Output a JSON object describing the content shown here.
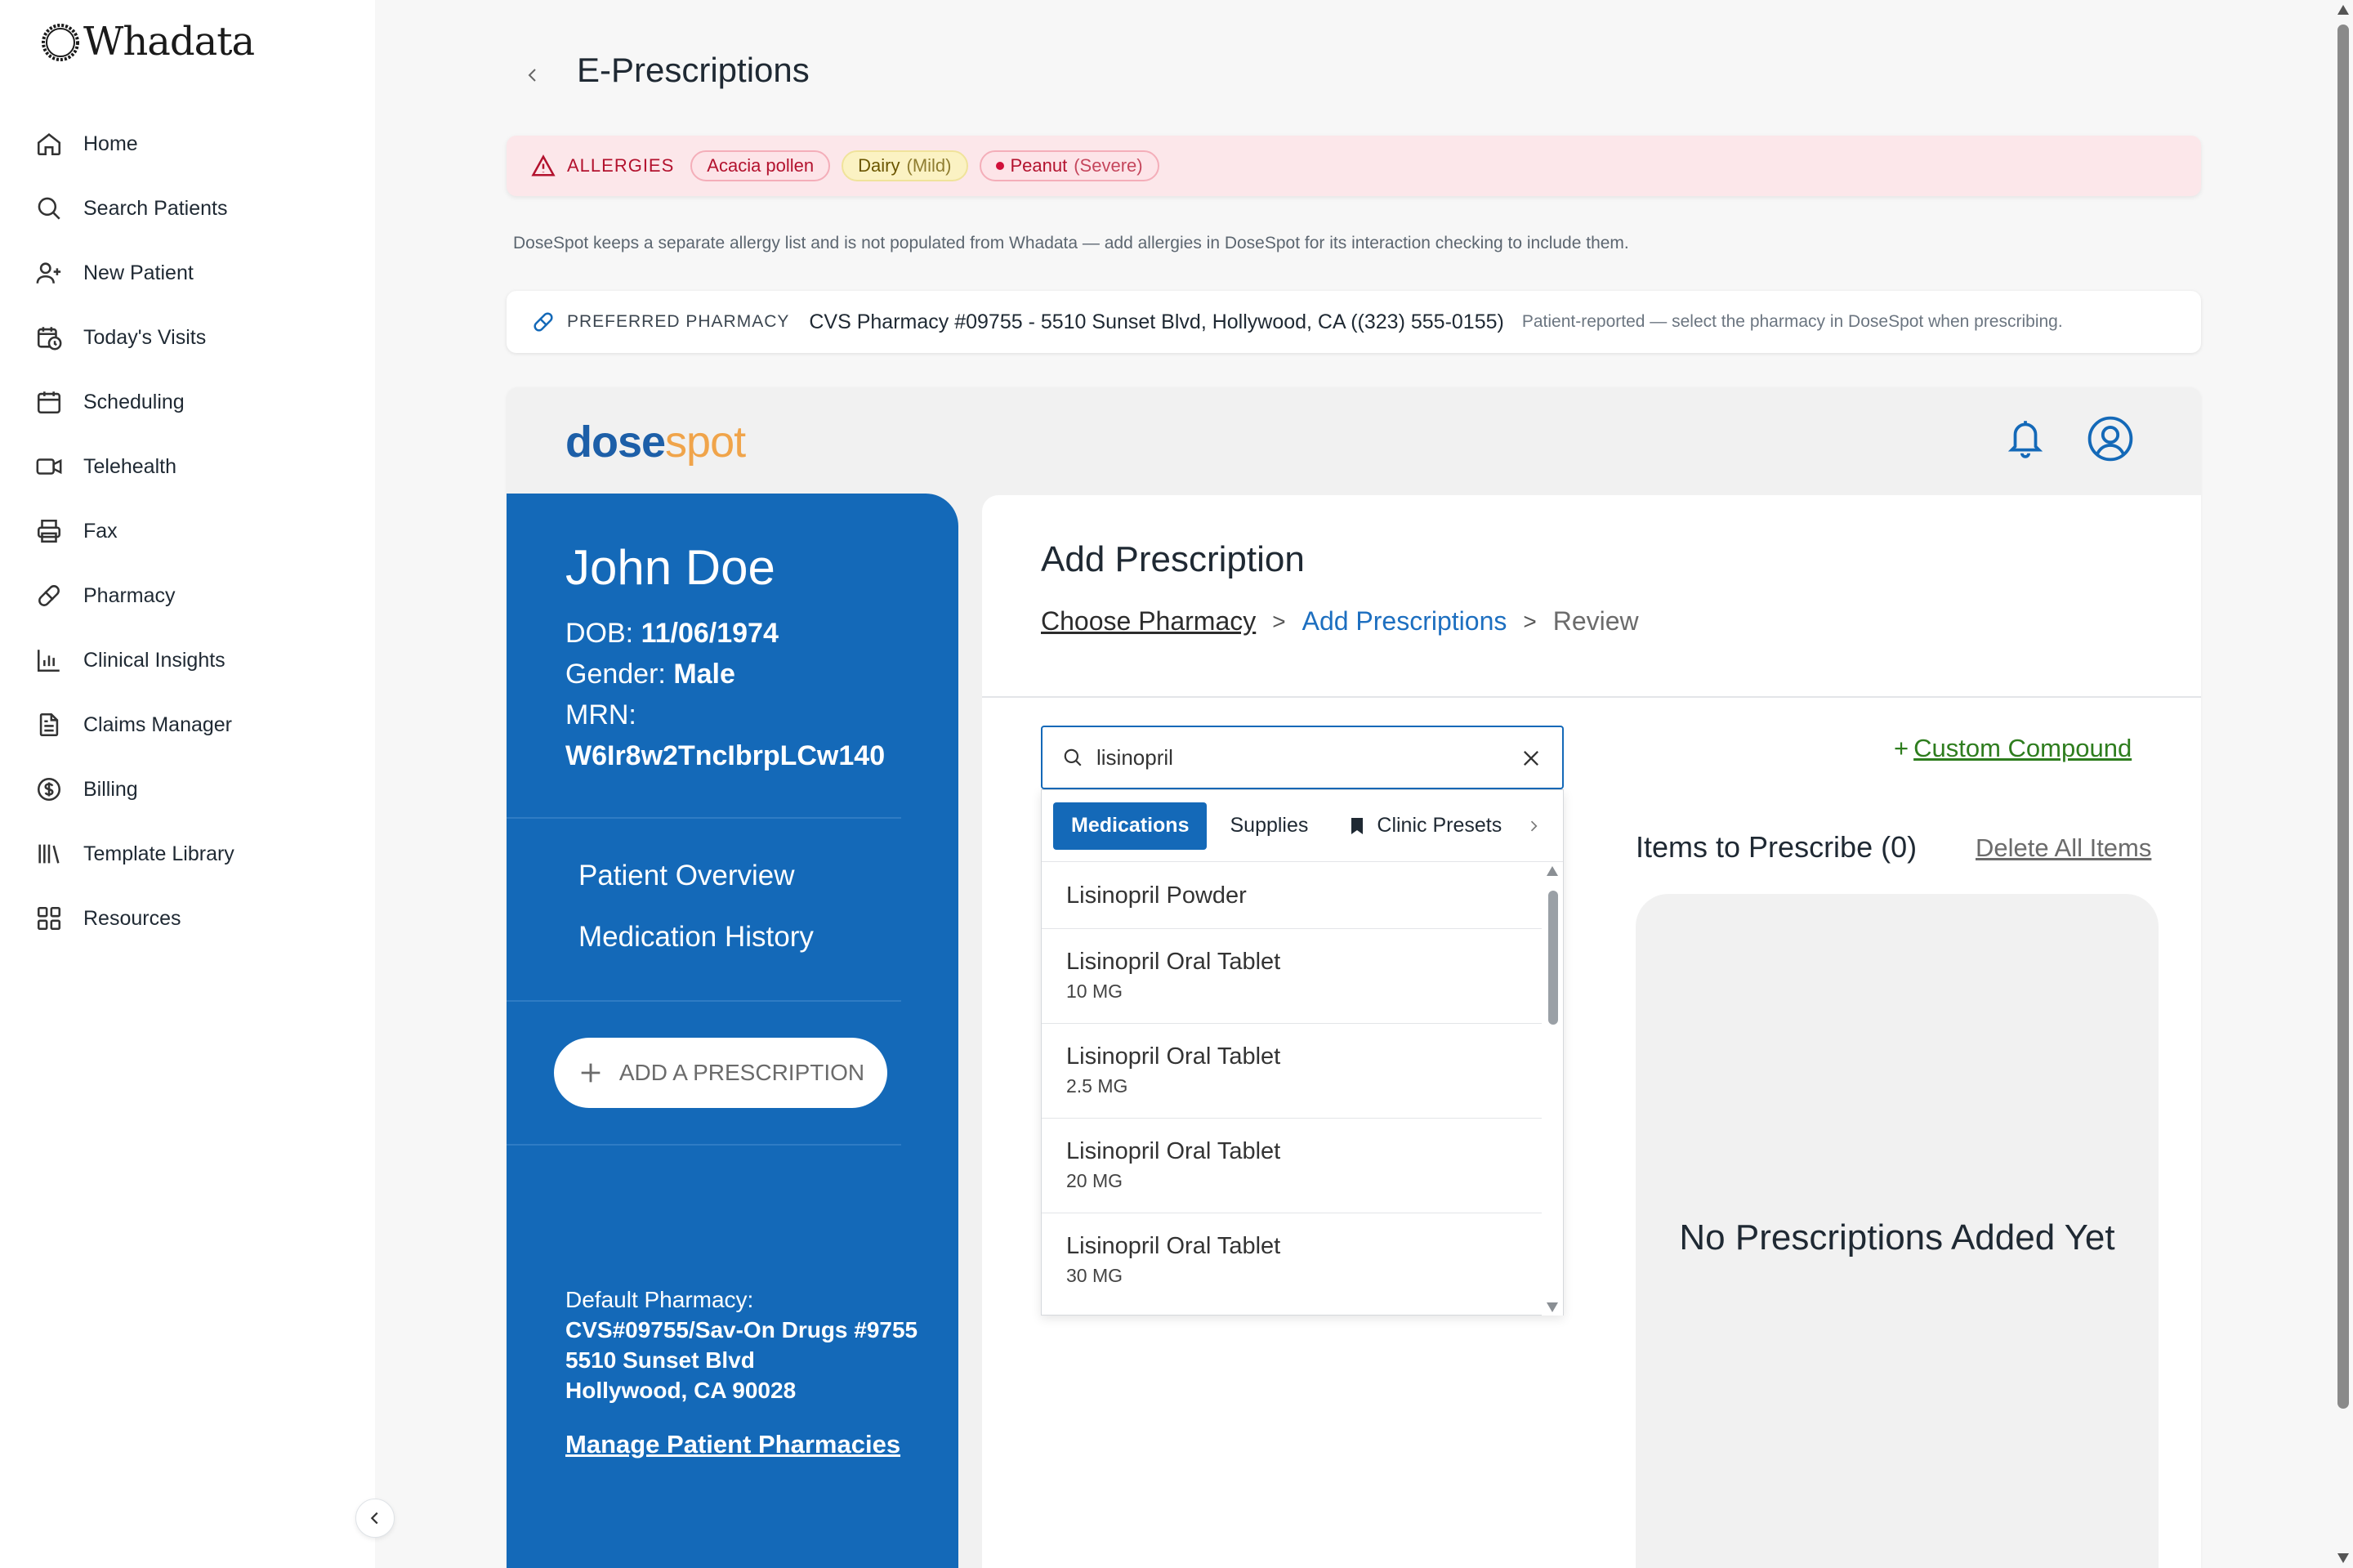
{
  "brand": {
    "logo_text": "Whadata"
  },
  "sidebar": {
    "items": [
      {
        "label": "Home",
        "icon": "home-icon"
      },
      {
        "label": "Search Patients",
        "icon": "search-icon"
      },
      {
        "label": "New Patient",
        "icon": "user-plus-icon"
      },
      {
        "label": "Today's Visits",
        "icon": "calendar-clock-icon"
      },
      {
        "label": "Scheduling",
        "icon": "calendar-icon"
      },
      {
        "label": "Telehealth",
        "icon": "video-icon"
      },
      {
        "label": "Fax",
        "icon": "printer-icon"
      },
      {
        "label": "Pharmacy",
        "icon": "pill-icon"
      },
      {
        "label": "Clinical Insights",
        "icon": "bar-chart-icon"
      },
      {
        "label": "Claims Manager",
        "icon": "document-icon"
      },
      {
        "label": "Billing",
        "icon": "dollar-icon"
      },
      {
        "label": "Template Library",
        "icon": "library-icon"
      },
      {
        "label": "Resources",
        "icon": "grid-icon"
      }
    ]
  },
  "page": {
    "title": "E-Prescriptions"
  },
  "allergies": {
    "label": "ALLERGIES",
    "items": [
      {
        "name": "Acacia pollen",
        "severity": ""
      },
      {
        "name": "Dairy",
        "severity": "(Mild)"
      },
      {
        "name": "Peanut",
        "severity": "(Severe)"
      }
    ],
    "note": "DoseSpot keeps a separate allergy list and is not populated from Whadata — add allergies in DoseSpot for its interaction checking to include them."
  },
  "preferred_pharmacy": {
    "label": "PREFERRED PHARMACY",
    "value": "CVS Pharmacy #09755 - 5510 Sunset Blvd, Hollywood, CA ((323) 555-0155)",
    "note": "Patient-reported — select the pharmacy in DoseSpot when prescribing."
  },
  "dosespot": {
    "logo_a": "dose",
    "logo_b": "spot",
    "patient": {
      "name": "John Doe",
      "dob_label": "DOB:",
      "dob": "11/06/1974",
      "gender_label": "Gender:",
      "gender": "Male",
      "mrn_label": "MRN:",
      "mrn": "W6Ir8w2TncIbrpLCw140",
      "links": [
        "Patient Overview",
        "Medication History"
      ],
      "add_button": "ADD A PRESCRIPTION",
      "default_pharmacy_label": "Default Pharmacy:",
      "default_pharmacy_lines": [
        "CVS#09755/Sav-On Drugs #9755",
        "5510 Sunset Blvd",
        "Hollywood, CA 90028"
      ],
      "manage_link": "Manage Patient Pharmacies"
    },
    "rx": {
      "title": "Add Prescription",
      "breadcrumbs": [
        "Choose Pharmacy",
        "Add Prescriptions",
        "Review"
      ],
      "breadcrumb_sep": ">",
      "search_value": "lisinopril",
      "tabs": [
        "Medications",
        "Supplies",
        "Clinic Presets"
      ],
      "results": [
        {
          "name": "Lisinopril Powder",
          "strength": ""
        },
        {
          "name": "Lisinopril Oral Tablet",
          "strength": "10 MG"
        },
        {
          "name": "Lisinopril Oral Tablet",
          "strength": "2.5 MG"
        },
        {
          "name": "Lisinopril Oral Tablet",
          "strength": "20 MG"
        },
        {
          "name": "Lisinopril Oral Tablet",
          "strength": "30 MG"
        }
      ],
      "custom_compound": "Custom Compound",
      "custom_compound_prefix": "+",
      "items_title": "Items to Prescribe (0)",
      "delete_all": "Delete All Items",
      "empty_message": "No Prescriptions Added Yet"
    }
  },
  "colors": {
    "brand_blue": "#1469b8",
    "allergy_red": "#b3122e",
    "compound_green": "#2e7d1e",
    "dose_orange": "#f0a44a"
  }
}
